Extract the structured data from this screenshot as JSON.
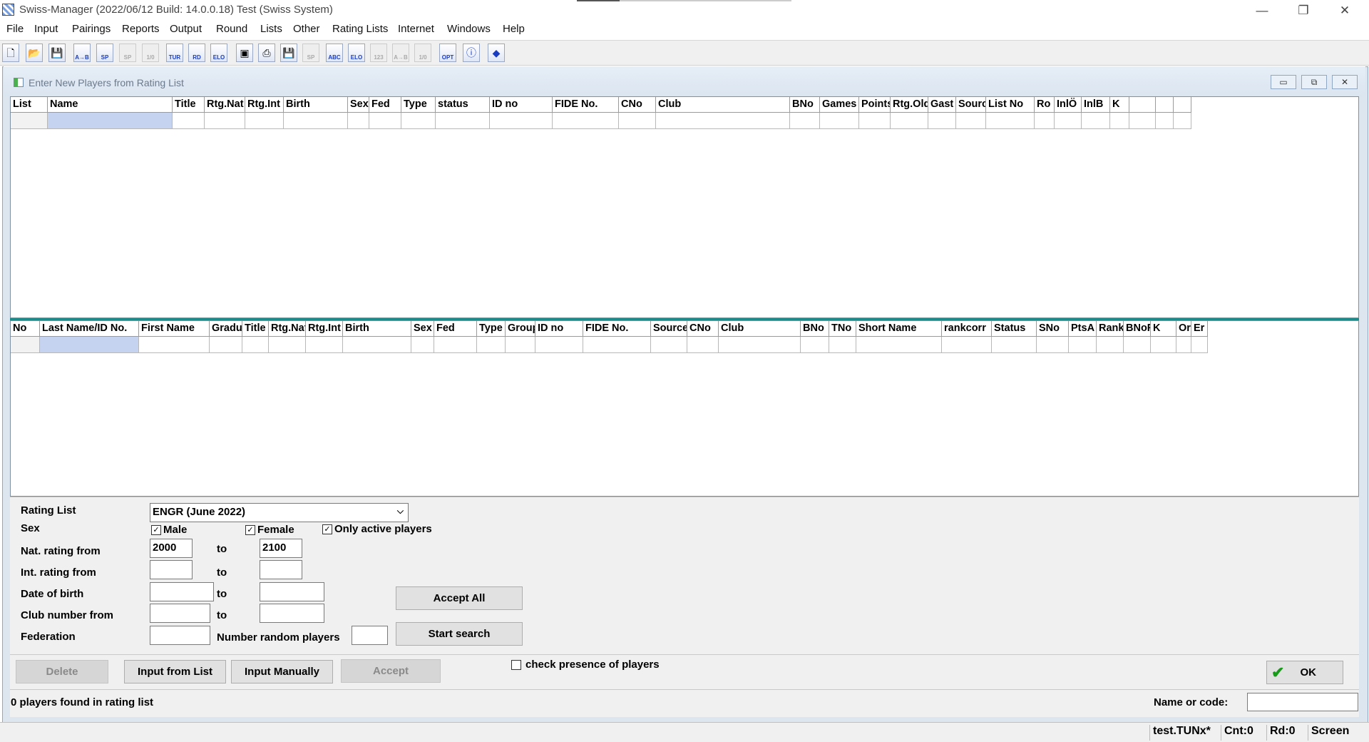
{
  "window": {
    "title": "Swiss-Manager (2022/06/12 Build: 14.0.0.18)  Test    (Swiss System)",
    "minimize": "—",
    "restore": "❐",
    "close": "✕"
  },
  "menu": [
    "File",
    "Input",
    "Pairings",
    "Reports",
    "Output",
    "Round",
    "Lists",
    "Other",
    "Rating Lists",
    "Internet",
    "Windows",
    "Help"
  ],
  "toolbar": {
    "icons": [
      "new-file-icon",
      "open-folder-icon",
      "save-icon",
      "pairing-ab-icon",
      "sp-icon",
      "sp-disabled-icon",
      "one-zero-disabled-icon",
      "tur-icon",
      "rd-icon",
      "elo-icon",
      "screen-icon",
      "print-icon",
      "save-icon-2",
      "sp-disabled-icon-2",
      "abc-icon",
      "elo-sort-icon",
      "123-disabled-icon",
      "ab-disabled-icon",
      "one-zero-disabled-icon-2",
      "opt-icon",
      "info-icon",
      "book-icon"
    ],
    "labels": [
      "",
      "",
      "",
      "A→B",
      "SP",
      "SP",
      "1/0",
      "TUR",
      "RD",
      "ELO",
      "",
      "",
      "",
      "SP",
      "ABC",
      "ELO",
      "123",
      "A→B",
      "1/0",
      "OPT",
      "",
      ""
    ]
  },
  "child_window": {
    "title": "Enter New Players from Rating List",
    "minimize": "▭",
    "restore": "⧉",
    "close": "✕"
  },
  "rating_list_grid": {
    "columns": [
      "List",
      "Name",
      "Title",
      "Rtg.Nat",
      "Rtg.Int",
      "Birth",
      "Sex",
      "Fed",
      "Type",
      "status",
      "ID no",
      "FIDE No.",
      "CNo",
      "Club",
      "BNo",
      "Games",
      "Points",
      "Rtg.Old",
      "Gast",
      "Source",
      "List No",
      "Ro",
      "InlÖ",
      "InlB",
      "K",
      "",
      "",
      ""
    ]
  },
  "players_grid": {
    "columns": [
      "No",
      "Last Name/ID No.",
      "First Name",
      "Gradu",
      "Title",
      "Rtg.Nat",
      "Rtg.Int",
      "Birth",
      "Sex",
      "Fed",
      "Type",
      "Group",
      "ID no",
      "FIDE No.",
      "Source",
      "CNo",
      "Club",
      "BNo",
      "TNo",
      "Short Name",
      "rankcorr",
      "Status",
      "SNo",
      "PtsA",
      "Rank",
      "BNoF",
      "K",
      "Or",
      "Er"
    ]
  },
  "form": {
    "rating_list_label": "Rating List",
    "rating_list_value": "ENGR (June 2022)",
    "sex_label": "Sex",
    "male_label": "Male",
    "male_checked": true,
    "female_label": "Female",
    "female_checked": true,
    "active_label": "Only active players",
    "active_checked": true,
    "nat_rating_label": "Nat. rating from",
    "nat_rating_from": "2000",
    "nat_rating_to": "2100",
    "int_rating_label": "Int. rating from",
    "dob_label": "Date of birth",
    "club_label": "Club number from",
    "federation_label": "Federation",
    "to_label": "to",
    "random_label": "Number random players",
    "accept_all": "Accept All",
    "start_search": "Start search"
  },
  "actions": {
    "delete": "Delete",
    "input_from_list": "Input from List",
    "input_manually": "Input Manually",
    "accept": "Accept",
    "check_presence": "check presence of players",
    "check_presence_checked": false,
    "ok": "OK"
  },
  "status": {
    "found": "0 players found in rating list",
    "name_or_code_label": "Name or code:"
  },
  "app_status": {
    "file": "test.TUNx*",
    "cnt": "Cnt:0",
    "rd": "Rd:0",
    "screen": "Screen"
  },
  "colors": {
    "accent": "#1f8a8a",
    "selected_cell": "#c5d3f0",
    "ok_check": "#1a9a1a"
  }
}
